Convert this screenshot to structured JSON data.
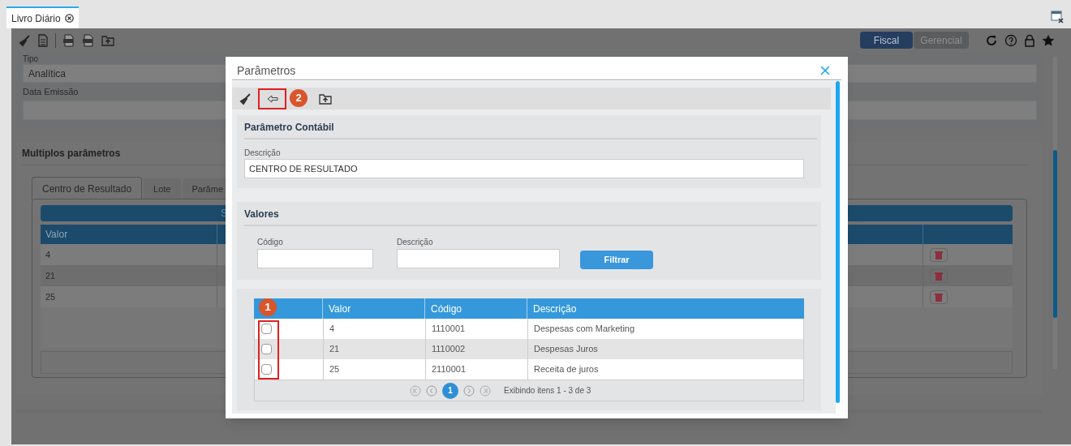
{
  "app_tabs": [
    {
      "label": "Livro Diário",
      "selected": true
    }
  ],
  "modes": [
    {
      "label": "Fiscal",
      "selected": true
    },
    {
      "label": "Gerencial",
      "selected": false
    }
  ],
  "filters": {
    "tipo_label": "Tipo",
    "tipo_value": "Analítica",
    "data_emissao_label": "Data Emissão"
  },
  "multi_params": {
    "title": "Multiplos parâmetros",
    "tabs": [
      {
        "label": "Centro de Resultado",
        "selected": true
      },
      {
        "label": "Lote",
        "selected": false
      },
      {
        "label": "Parâme",
        "selected": false
      }
    ],
    "table_title": "S",
    "columns": [
      "Valor"
    ],
    "rows": [
      {
        "valor": "4"
      },
      {
        "valor": "21"
      },
      {
        "valor": "25"
      }
    ]
  },
  "dialog": {
    "title": "Parâmetros",
    "section_1": {
      "title": "Parâmetro Contábil",
      "field_label": "Descrição",
      "field_value": "CENTRO DE RESULTADO"
    },
    "section_2": {
      "title": "Valores",
      "fields": [
        {
          "label": "Código"
        },
        {
          "label": "Descrição"
        }
      ],
      "button": "Filtrar"
    },
    "table": {
      "columns": [
        "Valor",
        "Código",
        "Descrição"
      ],
      "rows": [
        {
          "checked": false,
          "valor": "4",
          "codigo": "1110001",
          "descricao": "Despesas com Marketing"
        },
        {
          "checked": false,
          "valor": "21",
          "codigo": "1110002",
          "descricao": "Despesas Juros"
        },
        {
          "checked": false,
          "valor": "25",
          "codigo": "2110001",
          "descricao": "Receita de juros"
        }
      ]
    },
    "pager": {
      "pages": [
        {
          "label": "1",
          "selected": true
        }
      ],
      "summary": "Exibindo itens 1 - 3 de 3"
    }
  },
  "annotations": [
    {
      "label": "1"
    },
    {
      "label": "2"
    }
  ]
}
